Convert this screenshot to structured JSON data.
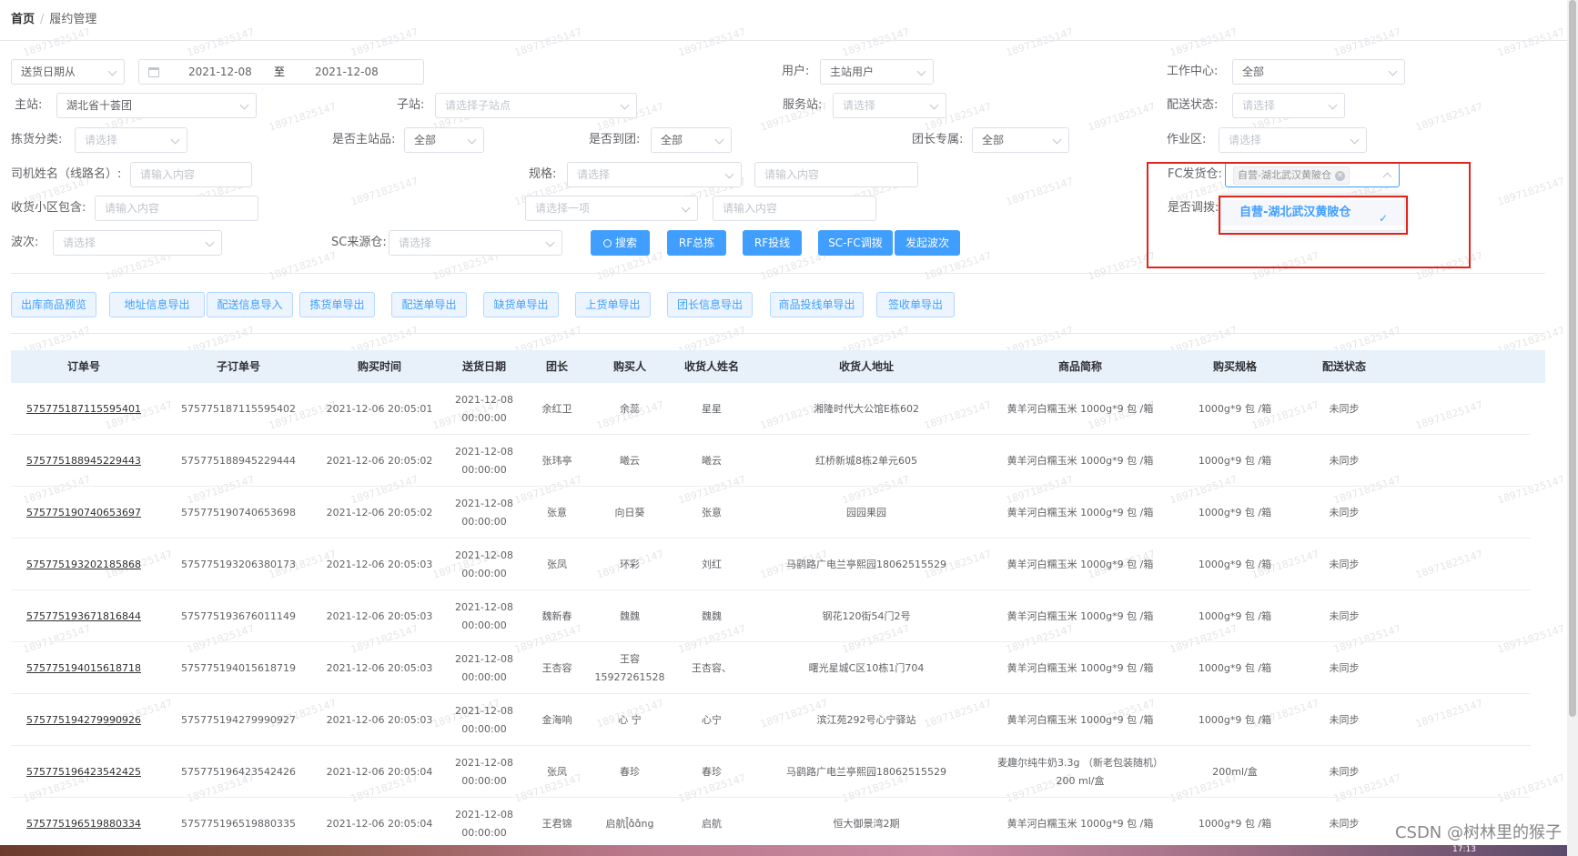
{
  "breadcrumb": {
    "home": "首页",
    "sep": "/",
    "current": "履约管理"
  },
  "filters": {
    "date_type": "送货日期从",
    "date_from": "2021-12-08",
    "date_to_sep": "至",
    "date_to": "2021-12-08",
    "user_label": "用户:",
    "user_value": "主站用户",
    "work_center_label": "工作中心:",
    "work_center_value": "全部",
    "main_station_label": "主站:",
    "main_station_value": "湖北省十荟团",
    "sub_station_label": "子站:",
    "sub_station_placeholder": "请选择子站点",
    "service_station_label": "服务站:",
    "service_station_placeholder": "请选择",
    "delivery_status_label": "配送状态:",
    "delivery_status_placeholder": "请选择",
    "pick_category_label": "拣货分类:",
    "pick_category_placeholder": "请选择",
    "is_main_item_label": "是否主站品:",
    "is_main_item_value": "全部",
    "is_arrived_label": "是否到团:",
    "is_arrived_value": "全部",
    "leader_exclusive_label": "团长专属:",
    "leader_exclusive_value": "全部",
    "work_area_label": "作业区:",
    "work_area_placeholder": "请选择",
    "driver_label": "司机姓名（线路名）:",
    "driver_placeholder": "请输入内容",
    "spec_label": "规格:",
    "spec_placeholder": "请选择",
    "spec_input_placeholder": "请输入内容",
    "fc_warehouse_label": "FC发货仓:",
    "fc_warehouse_tag": "自营-湖北武汉黄陂仓",
    "is_transfer_label": "是否调拨:",
    "receive_area_label": "收货小区包含:",
    "receive_area_placeholder": "请输入内容",
    "select_one_placeholder": "请选择一项",
    "extra_input_placeholder": "请输入内容",
    "wave_label": "波次:",
    "wave_placeholder": "请选择",
    "sc_source_label": "SC来源仓:",
    "sc_source_placeholder": "请选择"
  },
  "dropdown": {
    "option": "自营-湖北武汉黄陂仓",
    "check": "✓"
  },
  "actions": {
    "search": "搜索",
    "rf_summary": "RF总拣",
    "rf_delivery": "RF投线",
    "sc_fc_transfer": "SC-FC调拨",
    "launch_wave": "发起波次"
  },
  "exports": [
    "出库商品预览",
    "地址信息导出",
    "配送信息导入",
    "拣货单导出",
    "配送单导出",
    "缺货单导出",
    "上货单导出",
    "团长信息导出",
    "商品投线单导出",
    "签收单导出"
  ],
  "table": {
    "headers": [
      "订单号",
      "子订单号",
      "购买时间",
      "送货日期",
      "团长",
      "购买人",
      "收货人姓名",
      "收货人地址",
      "商品简称",
      "购买规格",
      "配送状态"
    ],
    "rows": [
      [
        "575775187115595401",
        "575775187115595402",
        "2021-12-06 20:05:01",
        "2021-12-08 00:00:00",
        "余红卫",
        "余蕊",
        "星星",
        "湘隆时代大公馆E栋602",
        "黄羊河白糯玉米 1000g*9 包 /箱",
        "1000g*9 包 /箱",
        "未同步"
      ],
      [
        "575775188945229443",
        "575775188945229444",
        "2021-12-06 20:05:02",
        "2021-12-08 00:00:00",
        "张玮亭",
        "曦云",
        "曦云",
        "红桥新城8栋2单元605",
        "黄羊河白糯玉米 1000g*9 包 /箱",
        "1000g*9 包 /箱",
        "未同步"
      ],
      [
        "575775190740653697",
        "575775190740653698",
        "2021-12-06 20:05:02",
        "2021-12-08 00:00:00",
        "张意",
        "向日葵",
        "张意",
        "园园果园",
        "黄羊河白糯玉米 1000g*9 包 /箱",
        "1000g*9 包 /箱",
        "未同步"
      ],
      [
        "575775193202185868",
        "575775193206380173",
        "2021-12-06 20:05:03",
        "2021-12-08 00:00:00",
        "张凤",
        "环彩",
        "刘红",
        "马鹞路广电兰亭熙园18062515529",
        "黄羊河白糯玉米 1000g*9 包 /箱",
        "1000g*9 包 /箱",
        "未同步"
      ],
      [
        "575775193671816844",
        "575775193676011149",
        "2021-12-06 20:05:03",
        "2021-12-08 00:00:00",
        "魏新春",
        "魏魏",
        "魏魏",
        "钢花120街54门2号",
        "黄羊河白糯玉米 1000g*9 包 /箱",
        "1000g*9 包 /箱",
        "未同步"
      ],
      [
        "575775194015618718",
        "575775194015618719",
        "2021-12-06 20:05:03",
        "2021-12-08 00:00:00",
        "王杏容",
        "王容15927261528",
        "王杏容、",
        "曙光星城C区10栋1门704",
        "黄羊河白糯玉米 1000g*9 包 /箱",
        "1000g*9 包 /箱",
        "未同步"
      ],
      [
        "575775194279990926",
        "575775194279990927",
        "2021-12-06 20:05:03",
        "2021-12-08 00:00:00",
        "金海响",
        "心 宁",
        "心宁",
        "滨江苑292号心宁驿站",
        "黄羊河白糯玉米 1000g*9 包 /箱",
        "1000g*9 包 /箱",
        "未同步"
      ],
      [
        "575775196423542425",
        "575775196423542426",
        "2021-12-06 20:05:04",
        "2021-12-08 00:00:00",
        "张凤",
        "春珍",
        "春珍",
        "马鹞路广电兰亭熙园18062515529",
        "麦趣尔纯牛奶3.3g （新老包装随机） 200 ml/盒",
        "200ml/盒",
        "未同步"
      ],
      [
        "575775196519880334",
        "575775196519880335",
        "2021-12-06 20:05:04",
        "2021-12-08 00:00:00",
        "王君锦",
        "启航ɭ̊ɑ̊ɑ̊ng",
        "启航",
        "恒大御景湾2期",
        "黄羊河白糯玉米 1000g*9 包 /箱",
        "1000g*9 包 /箱",
        "未同步"
      ]
    ]
  },
  "watermark_text": "18971825147",
  "csdn": "CSDN @树林里的猴子",
  "clock": "17:13"
}
